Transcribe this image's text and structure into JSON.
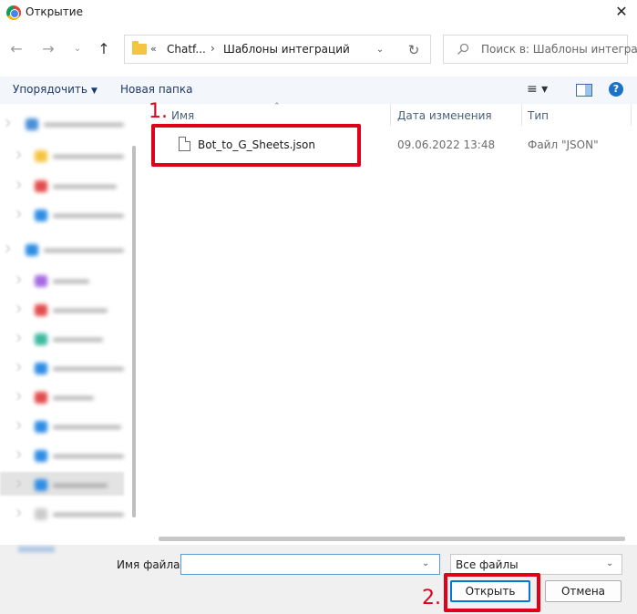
{
  "window": {
    "title": "Открытие",
    "close_glyph": "✕"
  },
  "nav": {
    "back_glyph": "←",
    "forward_glyph": "→",
    "recent_glyph": "⌄",
    "up_glyph": "↑",
    "address": {
      "overflow": "«",
      "crumbs": [
        "Chatf...",
        "Шаблоны интеграций"
      ],
      "separator": "›",
      "dropdown_glyph": "⌄",
      "refresh_glyph": "↻"
    },
    "search": {
      "placeholder": "Поиск в: Шаблоны интегра..."
    }
  },
  "commands": {
    "organize": "Упорядочить",
    "organize_caret": "▼",
    "new_folder": "Новая папка",
    "view_glyph": "≡ ▾",
    "help_glyph": "?"
  },
  "columns": {
    "name": "Имя",
    "date": "Дата изменения",
    "type": "Тип",
    "sort_glyph": "⌃"
  },
  "files": [
    {
      "name": "Bot_to_G_Sheets.json",
      "date": "09.06.2022 13:48",
      "type": "Файл \"JSON\""
    }
  ],
  "bottom": {
    "filename_label": "Имя файла:",
    "filename_value": "",
    "filter_value": "Все файлы",
    "dropdown_glyph": "⌄",
    "open_label": "Открыть",
    "cancel_label": "Отмена"
  },
  "annotations": {
    "step1": "1.",
    "step2": "2.",
    "color": "#e0001a"
  }
}
